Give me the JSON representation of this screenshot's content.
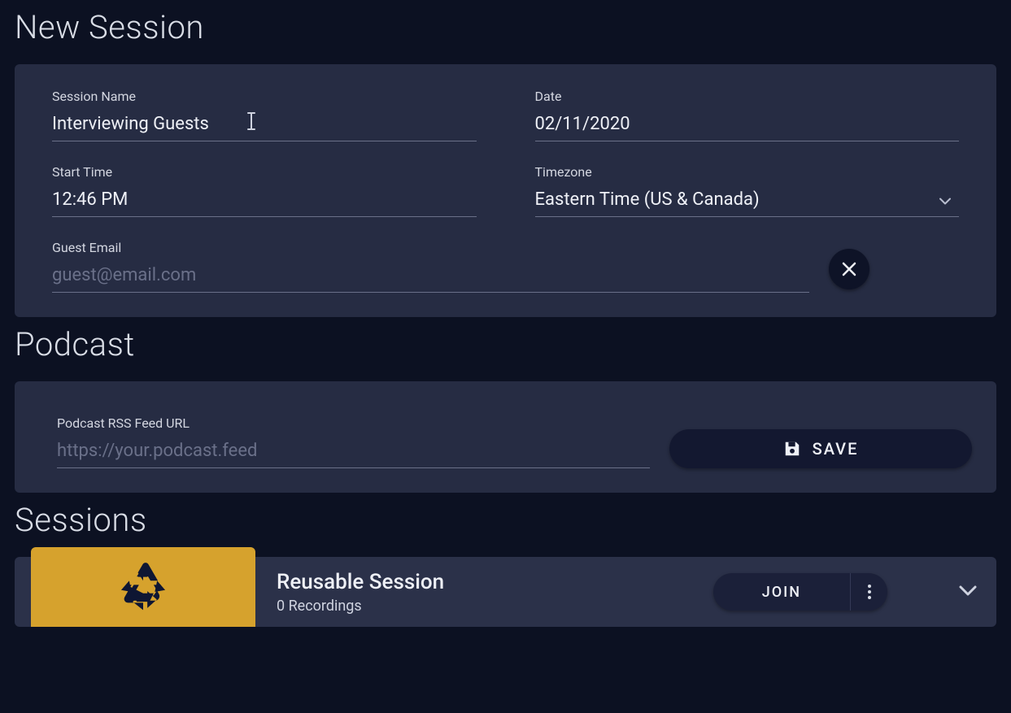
{
  "headings": {
    "new_session": "New Session",
    "podcast": "Podcast",
    "sessions": "Sessions"
  },
  "new_session_form": {
    "session_name": {
      "label": "Session Name",
      "value": "Interviewing Guests"
    },
    "date": {
      "label": "Date",
      "value": "02/11/2020"
    },
    "start_time": {
      "label": "Start Time",
      "value": "12:46 PM"
    },
    "timezone": {
      "label": "Timezone",
      "value": "Eastern Time (US & Canada)"
    },
    "guest_email": {
      "label": "Guest Email",
      "placeholder": "guest@email.com",
      "value": ""
    }
  },
  "podcast_form": {
    "rss": {
      "label": "Podcast RSS Feed URL",
      "placeholder": "https://your.podcast.feed",
      "value": ""
    },
    "save_label": "SAVE"
  },
  "sessions_list": [
    {
      "title": "Reusable Session",
      "subtitle": "0 Recordings",
      "join_label": "JOIN",
      "thumb_icon": "recycle",
      "thumb_color": "#d6a22d"
    }
  ]
}
